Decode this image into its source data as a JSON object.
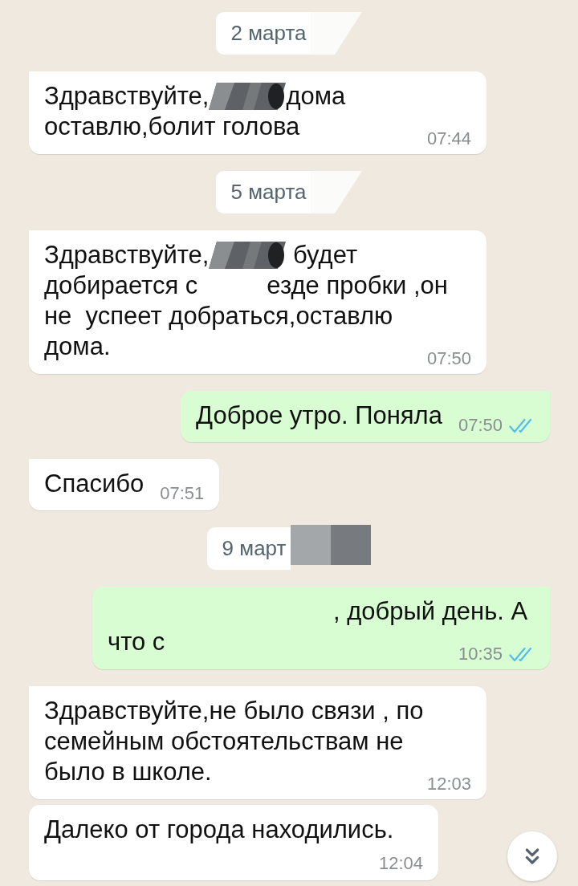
{
  "chat": {
    "items": [
      {
        "kind": "date",
        "parts": [
          {
            "kind": "text",
            "text": "2 марта"
          },
          {
            "kind": "smear"
          }
        ]
      },
      {
        "kind": "incoming",
        "lines": [
          [
            {
              "kind": "text",
              "text": "Здравствуйте,"
            },
            {
              "kind": "blot"
            },
            {
              "kind": "text",
              "text": "дома"
            }
          ],
          [
            {
              "kind": "text",
              "text": "оставлю,болит голова"
            }
          ]
        ],
        "time": "07:44"
      },
      {
        "kind": "date",
        "parts": [
          {
            "kind": "text",
            "text": "5 марта"
          },
          {
            "kind": "smear"
          }
        ]
      },
      {
        "kind": "incoming",
        "lines": [
          [
            {
              "kind": "text",
              "text": "Здравствуйте,"
            },
            {
              "kind": "blot"
            },
            {
              "kind": "text",
              "text": " будет"
            }
          ],
          [
            {
              "kind": "text",
              "text": "добирается с"
            },
            {
              "kind": "gap"
            },
            {
              "kind": "text",
              "text": "езде пробки ,он"
            }
          ],
          [
            {
              "kind": "text",
              "text": "не  успеет добраться,оставлю"
            }
          ],
          [
            {
              "kind": "text",
              "text": "дома."
            }
          ]
        ],
        "time": "07:50"
      },
      {
        "kind": "outgoing",
        "text": "Доброе утро. Поняла",
        "time": "07:50",
        "read": true
      },
      {
        "kind": "incoming",
        "text": "Спасибо",
        "time": "07:51"
      },
      {
        "kind": "date",
        "parts": [
          {
            "kind": "text",
            "text": "9 март"
          },
          {
            "kind": "pixels"
          }
        ]
      },
      {
        "kind": "outgoing",
        "lines": [
          [
            {
              "kind": "wide_gap"
            },
            {
              "kind": "text",
              "text": ", добрый день. А"
            }
          ],
          [
            {
              "kind": "text",
              "text": "что с"
            }
          ]
        ],
        "time": "10:35",
        "read": true
      },
      {
        "kind": "incoming",
        "text": "Здравствуйте,не было связи , по\nсемейным обстоятельствам не\nбыло в школе.",
        "time": "12:03"
      },
      {
        "kind": "incoming",
        "text": "Далеко от города находились.",
        "time": "12:04"
      }
    ]
  }
}
